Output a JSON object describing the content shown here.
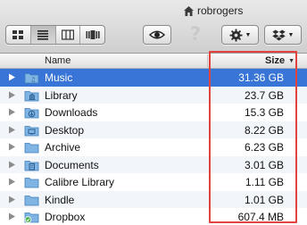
{
  "window": {
    "title": "robrogers"
  },
  "toolbar": {
    "view_modes": [
      "icon-view",
      "list-view",
      "column-view",
      "cover-flow-view"
    ],
    "active_view": "list-view",
    "help_glyph": "?"
  },
  "columns": {
    "name": "Name",
    "size": "Size"
  },
  "rows": [
    {
      "name": "Music",
      "size": "31.36 GB",
      "icon": "music-folder-icon",
      "selected": true
    },
    {
      "name": "Library",
      "size": "23.7 GB",
      "icon": "library-folder-icon"
    },
    {
      "name": "Downloads",
      "size": "15.3 GB",
      "icon": "downloads-folder-icon"
    },
    {
      "name": "Desktop",
      "size": "8.22 GB",
      "icon": "desktop-folder-icon"
    },
    {
      "name": "Archive",
      "size": "6.23 GB",
      "icon": "folder-icon"
    },
    {
      "name": "Documents",
      "size": "3.01 GB",
      "icon": "documents-folder-icon"
    },
    {
      "name": "Calibre Library",
      "size": "1.11 GB",
      "icon": "folder-icon"
    },
    {
      "name": "Kindle",
      "size": "1.01 GB",
      "icon": "folder-icon"
    },
    {
      "name": "Dropbox",
      "size": "607.4 MB",
      "icon": "dropbox-folder-icon"
    }
  ],
  "colors": {
    "selection": "#3875d7",
    "highlight_box": "#e2433f",
    "folder_blue": "#6fa8dc"
  }
}
